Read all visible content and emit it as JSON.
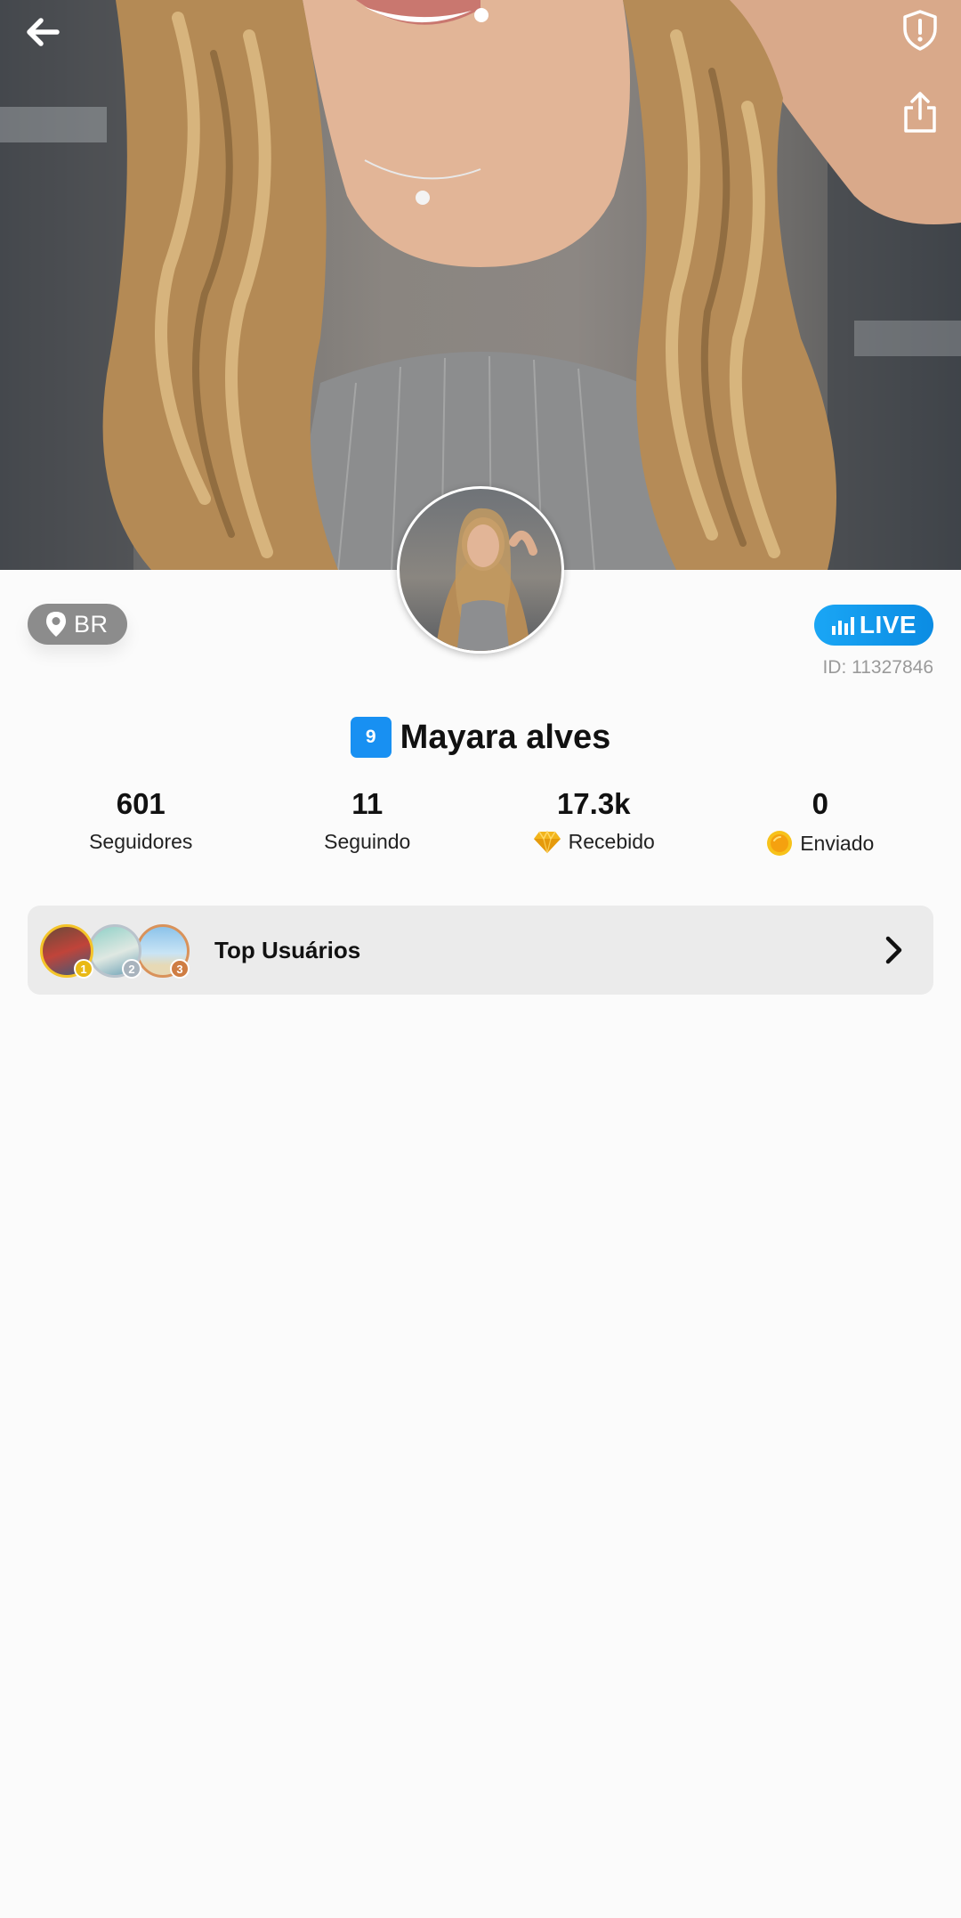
{
  "profile": {
    "country": "BR",
    "live_label": "LIVE",
    "user_id": "ID: 11327846",
    "level": "9",
    "name": "Mayara alves"
  },
  "stats": [
    {
      "value": "601",
      "label": "Seguidores",
      "icon": null
    },
    {
      "value": "11",
      "label": "Seguindo",
      "icon": null
    },
    {
      "value": "17.3k",
      "label": "Recebido",
      "icon": "diamond-icon"
    },
    {
      "value": "0",
      "label": "Enviado",
      "icon": "coin-icon"
    }
  ],
  "top_users": {
    "label": "Top Usuários",
    "medals": [
      "1",
      "2",
      "3"
    ]
  },
  "icons": {
    "back": "arrow-left-icon",
    "report": "shield-alert-icon",
    "share": "share-icon",
    "location": "location-pin-icon",
    "live": "signal-bars-icon",
    "chevron": "chevron-right-icon"
  },
  "colors": {
    "accent_blue": "#1890f2",
    "live_gradient_start": "#1aa6f5",
    "chip_gray": "#8c8c8c",
    "card_bg": "#ebebeb",
    "gold": "#f4c429"
  }
}
